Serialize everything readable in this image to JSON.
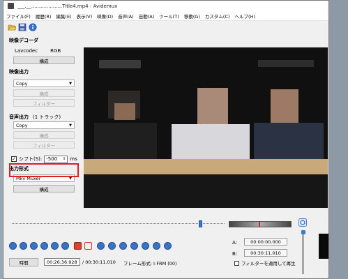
{
  "window": {
    "title": "___.__....................Title4.mp4 - Avidemux"
  },
  "menu": [
    "ファイル(F)",
    "履歴(R)",
    "編集(E)",
    "表示(V)",
    "映像(D)",
    "音声(A)",
    "自動(A)",
    "ツール(T)",
    "移動(G)",
    "カスタム(C)",
    "ヘルプ(H)"
  ],
  "video_decoder": {
    "title": "映像デコーダ",
    "codec": "Lavcodec",
    "format": "RGB",
    "configure": "構成"
  },
  "video_output": {
    "title": "映像出力",
    "codec": "Copy",
    "configure": "構成",
    "filter": "フィルター"
  },
  "audio_output": {
    "title": "音声出力",
    "tracks": "(1 トラック)",
    "codec": "Copy",
    "configure": "構成",
    "filter": "フィルター"
  },
  "shift": {
    "label": "シフト(S):",
    "value": "-500",
    "unit": "ms",
    "checked": true
  },
  "output_format": {
    "title": "出力形式",
    "muxer": "Mkv Muxer",
    "configure": "構成"
  },
  "status": {
    "time_button": "時間",
    "current_time": "00:26:36.928",
    "total_time": "/ 00:30:11.010",
    "frame_type": "フレーム形式: I-FRM (00)"
  },
  "markers": {
    "a_label": "A:",
    "a_time": "00:00:00.000",
    "b_label": "B:",
    "b_time": "00:30:11.010",
    "filter_playback": "フィルターを適用して再生"
  },
  "playback": {
    "position": 0.88
  }
}
